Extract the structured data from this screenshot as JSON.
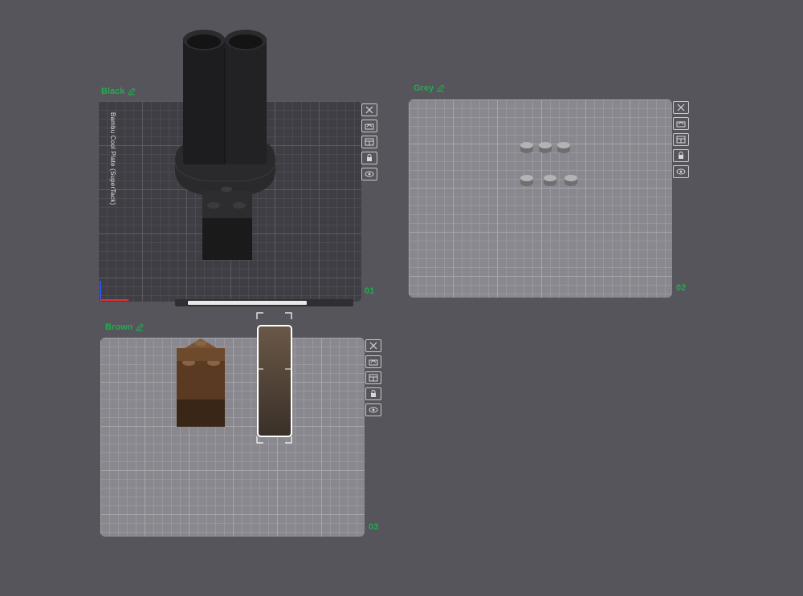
{
  "plates": [
    {
      "name": "Black",
      "number": "01",
      "bed_label": "Bambu Cool Plate (SuperTack)",
      "theme": "dark"
    },
    {
      "name": "Grey",
      "number": "02",
      "theme": "light"
    },
    {
      "name": "Brown",
      "number": "03",
      "theme": "light"
    }
  ],
  "plate_toolbar_icons": [
    "close-icon",
    "auto-orient-icon",
    "arrange-icon",
    "lock-icon",
    "eye-icon"
  ],
  "colors": {
    "background": "#55555b",
    "label_green": "#1fae4f",
    "black_filament": "#1e1e1f",
    "grey_filament": "#8a8a8d",
    "brown_filament": "#5a3a22",
    "selection": "#ffffff"
  },
  "slicing_progress": 0.78
}
